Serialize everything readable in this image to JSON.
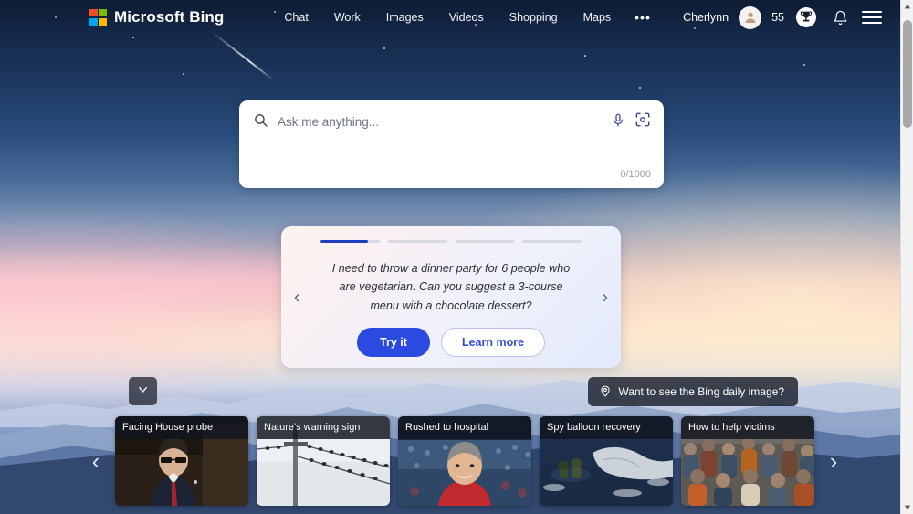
{
  "header": {
    "brand": "Microsoft Bing",
    "logo_icon": "microsoft-squares-logo",
    "nav": [
      {
        "label": "Chat"
      },
      {
        "label": "Work"
      },
      {
        "label": "Images"
      },
      {
        "label": "Videos"
      },
      {
        "label": "Shopping"
      },
      {
        "label": "Maps"
      }
    ],
    "more_label": "•••",
    "user_name": "Cherlynn",
    "avatar_icon": "user-avatar-icon",
    "rewards_count": "55",
    "rewards_icon": "rewards-trophy-icon",
    "notifications_icon": "bell-icon",
    "menu_icon": "hamburger-menu-icon"
  },
  "search": {
    "placeholder": "Ask me anything...",
    "value": "",
    "char_count": "0/1000",
    "search_icon": "search-icon",
    "mic_icon": "microphone-icon",
    "visual_icon": "visual-search-camera-icon"
  },
  "suggestion": {
    "prompt": "I need to throw a dinner party for 6 people who are vegetarian. Can you suggest a 3-course menu with a chocolate dessert?",
    "try_label": "Try it",
    "learn_label": "Learn more",
    "prev_icon": "chevron-left-icon",
    "next_icon": "chevron-right-icon",
    "progress": [
      80,
      0,
      0,
      0
    ],
    "accent_color": "#2b4ae0",
    "progress_fill_color": "#1f3fba"
  },
  "daily_image": {
    "label": "Want to see the Bing daily image?",
    "icon": "location-pin-icon"
  },
  "collapse": {
    "icon": "chevron-down-icon"
  },
  "news": {
    "prev_icon": "carousel-prev-chevron-icon",
    "next_icon": "carousel-next-chevron-icon",
    "cards": [
      {
        "title": "Facing House probe",
        "thumb": "man-in-suit-glasses-hearing"
      },
      {
        "title": "Nature's warning sign",
        "thumb": "birds-on-power-lines"
      },
      {
        "title": "Rushed to hospital",
        "thumb": "man-red-shirt-stadium"
      },
      {
        "title": "Spy balloon recovery",
        "thumb": "navy-crew-recovering-debris-at-sea"
      },
      {
        "title": "How to help victims",
        "thumb": "crowd-of-people-receiving-aid"
      }
    ]
  },
  "scrollbar": {
    "up_icon": "scroll-up-arrow-icon",
    "down_icon": "scroll-down-arrow-icon"
  }
}
